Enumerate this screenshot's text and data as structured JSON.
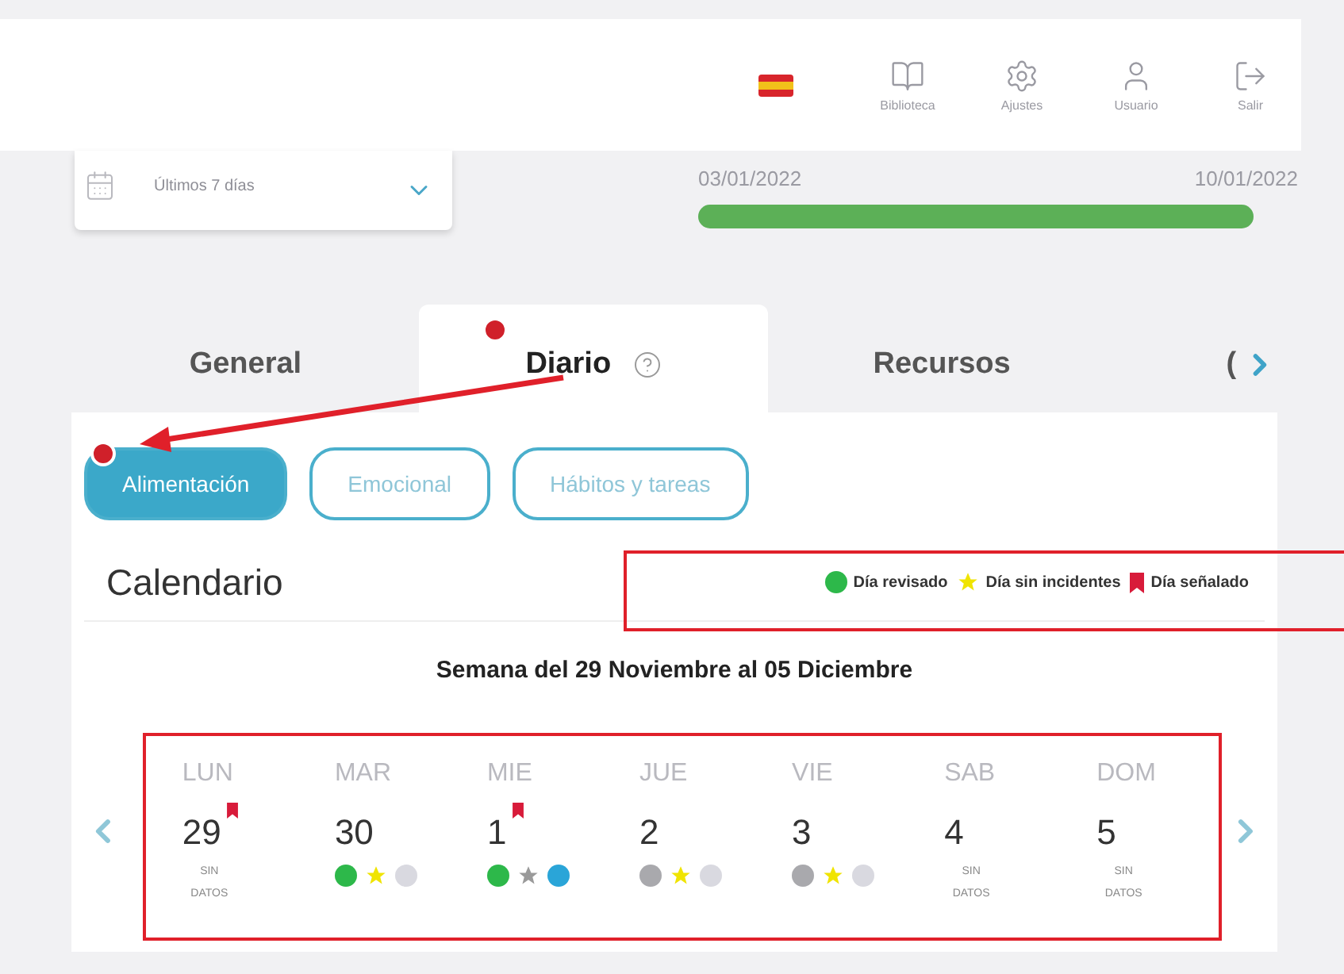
{
  "header": {
    "nav": [
      {
        "kind": "book",
        "label": "Biblioteca"
      },
      {
        "kind": "settings",
        "label": "Ajustes"
      },
      {
        "kind": "user",
        "label": "Usuario"
      },
      {
        "kind": "logout",
        "label": "Salir"
      }
    ]
  },
  "period_select": {
    "value": "Últimos 7 días"
  },
  "date_range": {
    "start": "03/01/2022",
    "end": "10/01/2022",
    "level": 1
  },
  "tabs": [
    {
      "label": "General",
      "selected": false,
      "alert": false,
      "help": false
    },
    {
      "label": "Diario",
      "selected": true,
      "alert": true,
      "help": true
    },
    {
      "label": "Recursos",
      "selected": false,
      "alert": false,
      "help": false
    },
    {
      "label": "(",
      "selected": false,
      "alert": false,
      "help": false
    }
  ],
  "sub_tabs": [
    {
      "label": "Alimentación",
      "selected": true,
      "alert": true
    },
    {
      "label": "Emocional",
      "selected": false,
      "alert": false
    },
    {
      "label": "Hábitos y tareas",
      "selected": false,
      "alert": false
    }
  ],
  "calendar": {
    "title": "Calendario",
    "legend": [
      {
        "kind": "dot",
        "color": "#2db84a",
        "label": "Día revisado"
      },
      {
        "kind": "star",
        "color": "#f0e400",
        "label": "Día sin incidentes"
      },
      {
        "kind": "bookmark",
        "color": "#d81b3a",
        "label": "Día señalado"
      }
    ],
    "week_title": "Semana del 29 Noviembre al 05 Diciembre",
    "days": [
      {
        "name": "LUN",
        "number": "29",
        "bookmarked": true,
        "no_data": "SIN DATOS"
      },
      {
        "name": "MAR",
        "number": "30",
        "bookmarked": false,
        "marks": [
          {
            "kind": "dot",
            "color": "#2db84a"
          },
          {
            "kind": "star",
            "color": "#f0e400"
          },
          {
            "kind": "dot",
            "color": "#d9d9e0"
          }
        ]
      },
      {
        "name": "MIE",
        "number": "1",
        "bookmarked": true,
        "marks": [
          {
            "kind": "dot",
            "color": "#2db84a"
          },
          {
            "kind": "star",
            "color": "#9a9a9a"
          },
          {
            "kind": "dot",
            "color": "#2aa5d8"
          }
        ]
      },
      {
        "name": "JUE",
        "number": "2",
        "bookmarked": false,
        "marks": [
          {
            "kind": "dot",
            "color": "#a9a9ad"
          },
          {
            "kind": "star",
            "color": "#f0e400"
          },
          {
            "kind": "dot",
            "color": "#d9d9e0"
          }
        ]
      },
      {
        "name": "VIE",
        "number": "3",
        "bookmarked": false,
        "marks": [
          {
            "kind": "dot",
            "color": "#a9a9ad"
          },
          {
            "kind": "star",
            "color": "#f0e400"
          },
          {
            "kind": "dot",
            "color": "#d9d9e0"
          }
        ]
      },
      {
        "name": "SAB",
        "number": "4",
        "bookmarked": false,
        "no_data": "SIN DATOS"
      },
      {
        "name": "DOM",
        "number": "5",
        "bookmarked": false,
        "no_data": "SIN DATOS"
      }
    ]
  }
}
